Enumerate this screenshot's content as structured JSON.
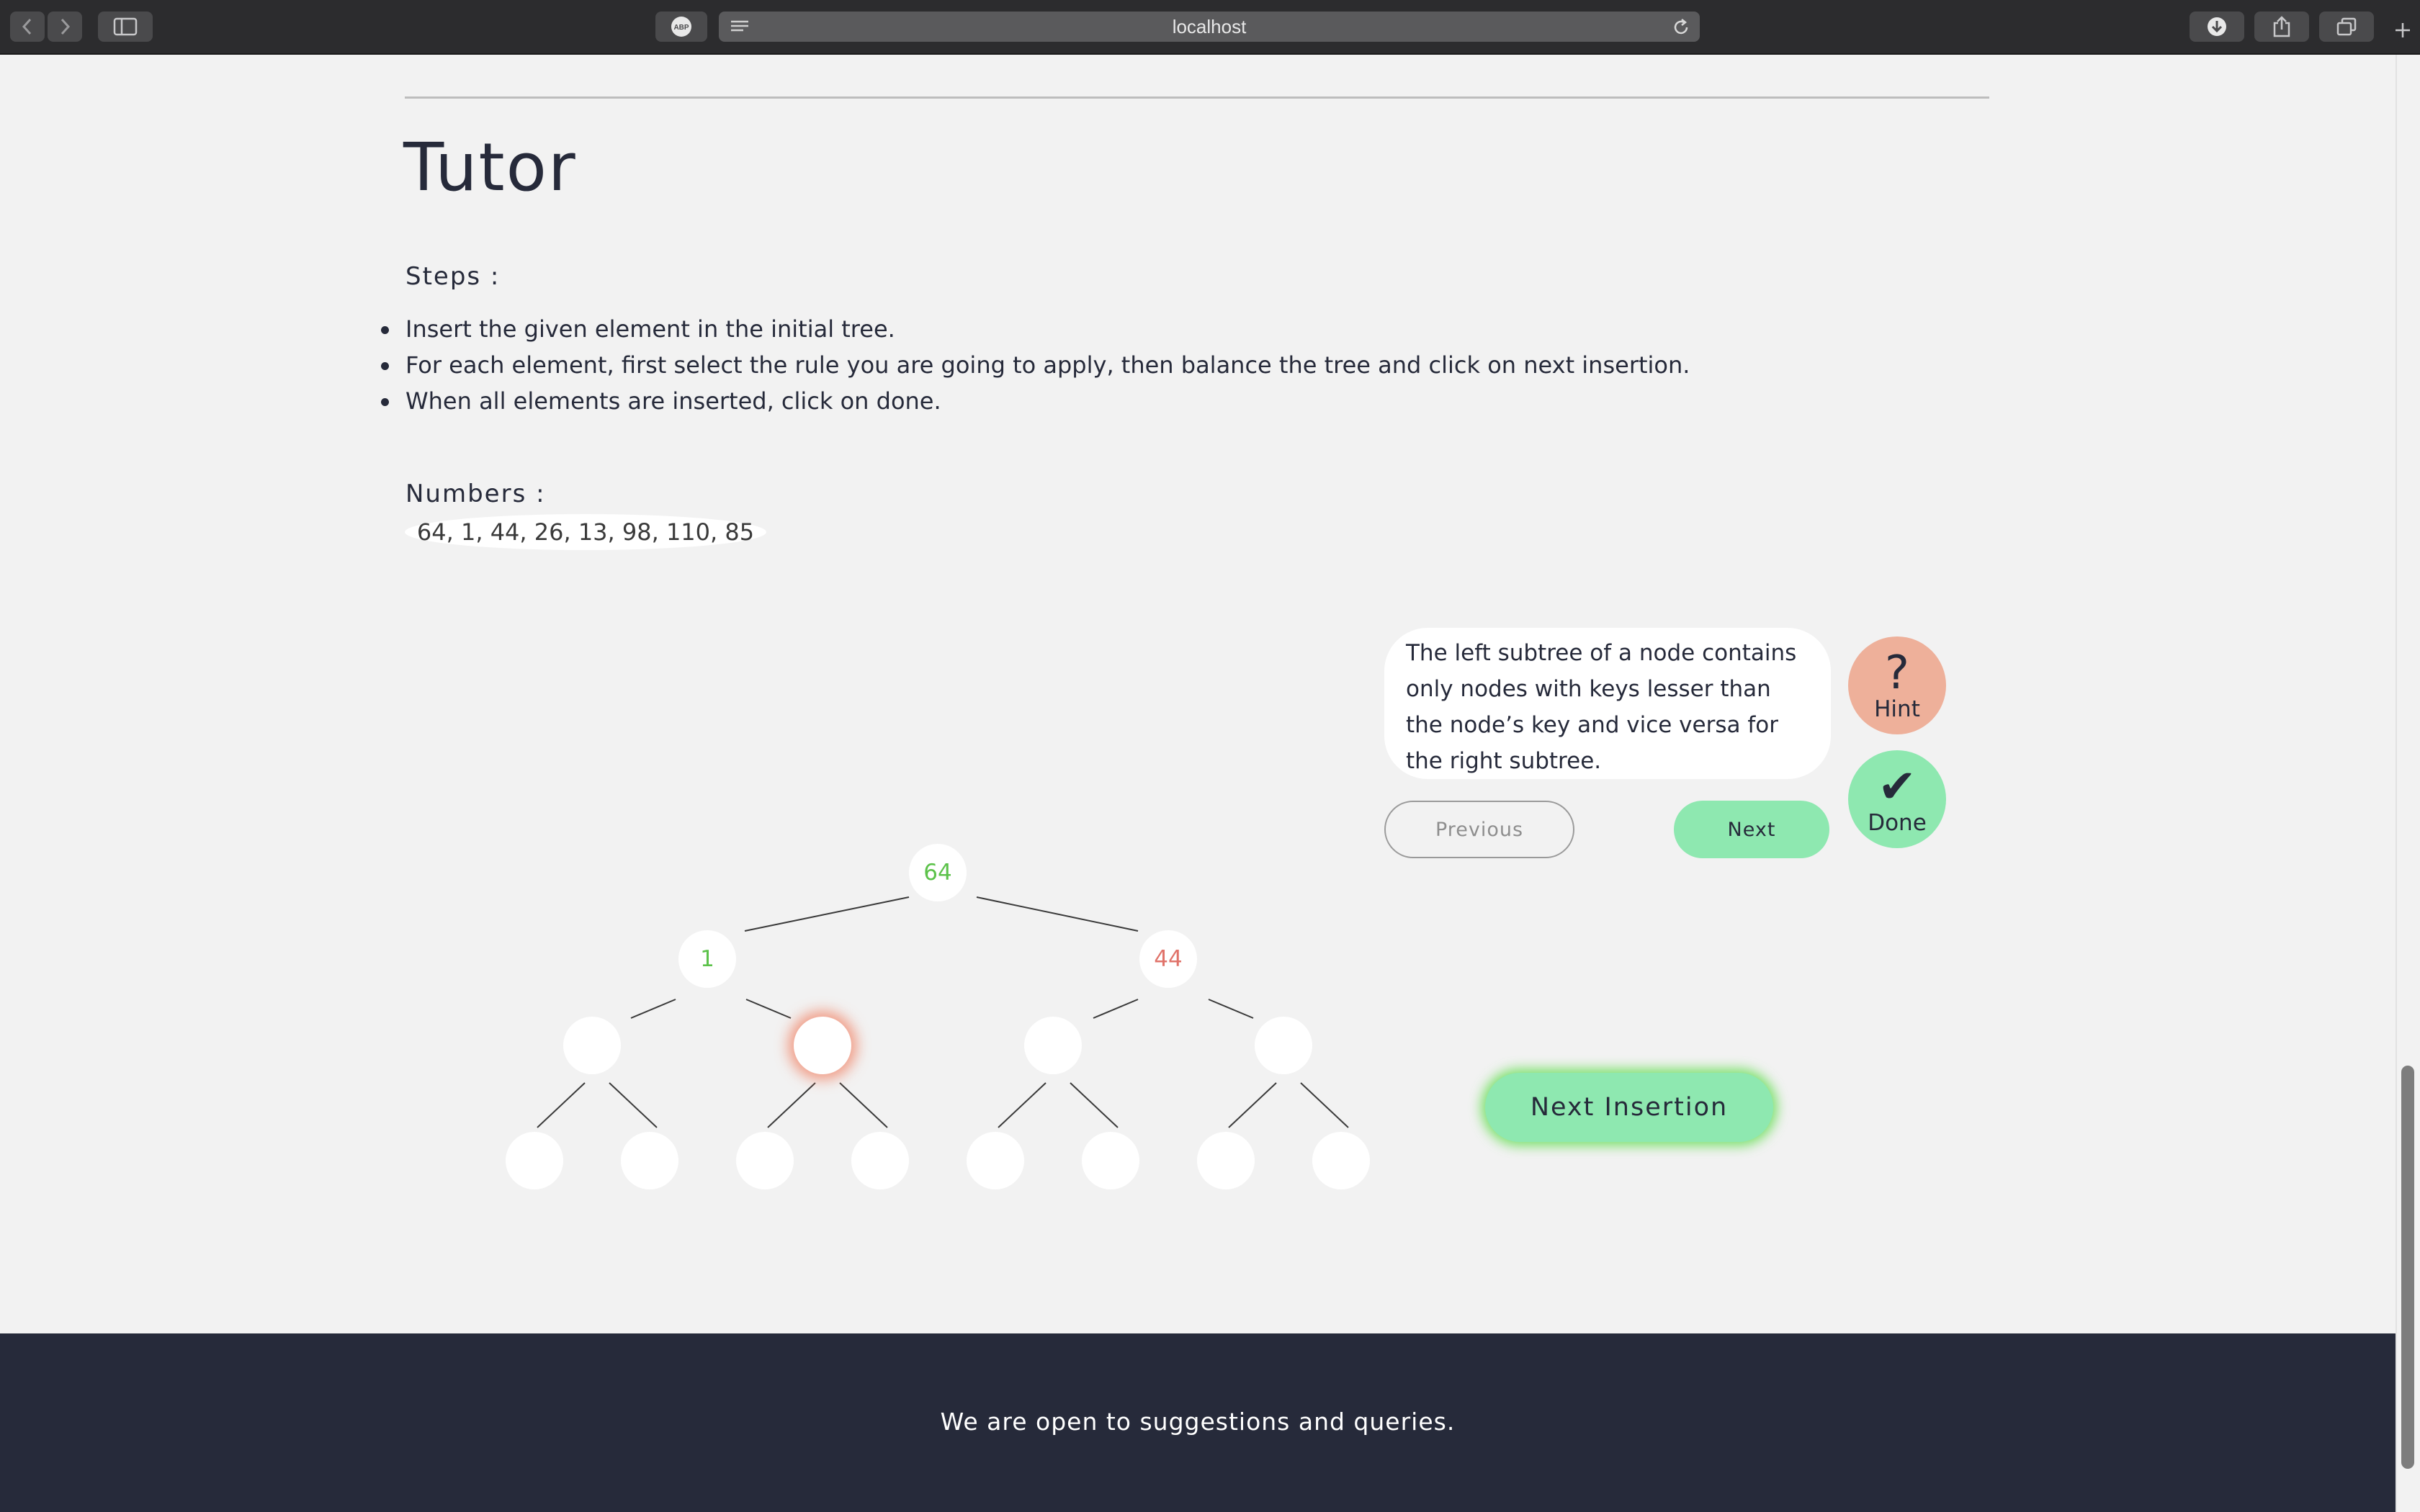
{
  "browser": {
    "url": "localhost",
    "adblock_label": "ABP"
  },
  "page": {
    "title": "Tutor",
    "steps_label": "Steps :",
    "steps": [
      "Insert the given element in the initial tree.",
      "For each element, first select the rule you are going to apply, then balance the tree and click on next insertion.",
      "When all elements are inserted, click on done."
    ],
    "numbers_label": "Numbers :",
    "numbers": "64, 1, 44, 26, 13, 98, 110, 85"
  },
  "tree": {
    "nodes": [
      {
        "id": "n1",
        "value": "64",
        "color": "#5cc24a"
      },
      {
        "id": "n2",
        "value": "1",
        "color": "#5cc24a"
      },
      {
        "id": "n3",
        "value": "44",
        "color": "#e0736a"
      },
      {
        "id": "n4",
        "value": ""
      },
      {
        "id": "n5",
        "value": "",
        "selected": true
      },
      {
        "id": "n6",
        "value": ""
      },
      {
        "id": "n7",
        "value": ""
      },
      {
        "id": "n8",
        "value": ""
      },
      {
        "id": "n9",
        "value": ""
      },
      {
        "id": "n10",
        "value": ""
      },
      {
        "id": "n11",
        "value": ""
      },
      {
        "id": "n12",
        "value": ""
      },
      {
        "id": "n13",
        "value": ""
      },
      {
        "id": "n14",
        "value": ""
      },
      {
        "id": "n15",
        "value": ""
      }
    ]
  },
  "hint_panel": {
    "text": "The left subtree of a node contains only nodes with keys lesser than the node’s key and vice versa for the right subtree.",
    "previous_label": "Previous",
    "next_label": "Next",
    "hint_label": "Hint",
    "hint_glyph": "?",
    "done_label": "Done",
    "done_glyph": "✔"
  },
  "next_insertion_label": "Next Insertion",
  "footer": {
    "text": "We are open to suggestions and queries."
  },
  "colors": {
    "accent_green": "#8ee8b0",
    "hint_salmon": "#eeb09a",
    "dark_navy": "#262a3a",
    "node_value_green": "#5cc24a",
    "node_value_red": "#e0736a"
  }
}
